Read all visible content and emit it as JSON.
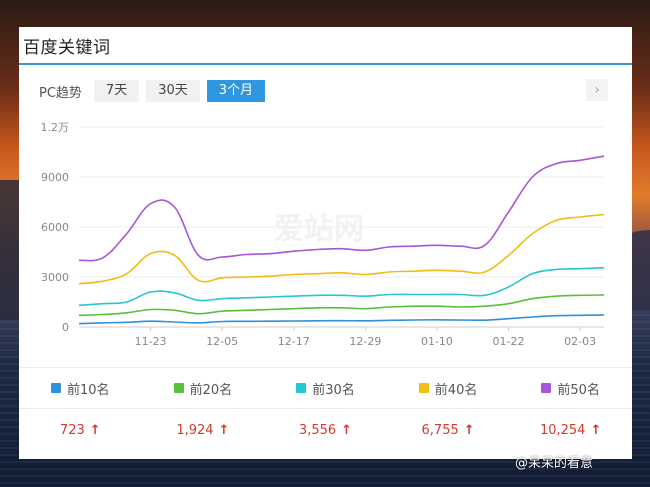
{
  "card": {
    "title": "百度关键词"
  },
  "tabs": {
    "label": "PC趋势",
    "items": [
      {
        "label": "7天",
        "active": false
      },
      {
        "label": "30天",
        "active": false
      },
      {
        "label": "3个月",
        "active": true
      }
    ],
    "next_icon": "chevron-right-icon"
  },
  "watermark": "爱站网",
  "chart_data": {
    "type": "line",
    "x": [
      "11-12",
      "11-16",
      "11-20",
      "11-23",
      "11-27",
      "12-01",
      "12-05",
      "12-09",
      "12-13",
      "12-17",
      "12-21",
      "12-25",
      "12-29",
      "01-02",
      "01-06",
      "01-10",
      "01-14",
      "01-18",
      "01-22",
      "01-26",
      "01-30",
      "02-03",
      "02-06"
    ],
    "xticks": [
      "11-23",
      "12-05",
      "12-17",
      "12-29",
      "01-10",
      "01-22",
      "02-03"
    ],
    "yticks": [
      "0",
      "3000",
      "6000",
      "9000",
      "1.2万"
    ],
    "ylim": [
      0,
      12000
    ],
    "grid": true,
    "legend": "bottom",
    "series": [
      {
        "name": "前10名",
        "color": "#2f91dc",
        "values": [
          200,
          250,
          280,
          350,
          300,
          250,
          330,
          340,
          350,
          360,
          370,
          380,
          370,
          400,
          420,
          430,
          420,
          410,
          500,
          600,
          680,
          700,
          723
        ]
      },
      {
        "name": "前20名",
        "color": "#56c13a",
        "values": [
          700,
          750,
          850,
          1050,
          1000,
          800,
          950,
          1000,
          1050,
          1100,
          1150,
          1150,
          1100,
          1200,
          1250,
          1250,
          1200,
          1250,
          1400,
          1700,
          1850,
          1900,
          1924
        ]
      },
      {
        "name": "前30名",
        "color": "#27c6d4",
        "values": [
          1300,
          1400,
          1500,
          2100,
          2050,
          1600,
          1700,
          1750,
          1800,
          1850,
          1900,
          1900,
          1850,
          1950,
          1950,
          1950,
          1950,
          1900,
          2400,
          3200,
          3450,
          3500,
          3556
        ]
      },
      {
        "name": "前40名",
        "color": "#f1bc16",
        "values": [
          2600,
          2750,
          3200,
          4400,
          4300,
          2800,
          2950,
          3000,
          3050,
          3150,
          3200,
          3250,
          3150,
          3300,
          3350,
          3400,
          3350,
          3300,
          4300,
          5600,
          6400,
          6600,
          6755
        ]
      },
      {
        "name": "前50名",
        "color": "#a656d8",
        "values": [
          4000,
          4150,
          5600,
          7400,
          7200,
          4300,
          4200,
          4350,
          4400,
          4550,
          4650,
          4700,
          4600,
          4800,
          4850,
          4900,
          4850,
          4900,
          6900,
          9000,
          9800,
          10000,
          10254
        ]
      }
    ]
  },
  "totals": [
    {
      "value": "723"
    },
    {
      "value": "1,924"
    },
    {
      "value": "3,556"
    },
    {
      "value": "6,755"
    },
    {
      "value": "10,254"
    }
  ],
  "caption": "@呆呆的看意"
}
